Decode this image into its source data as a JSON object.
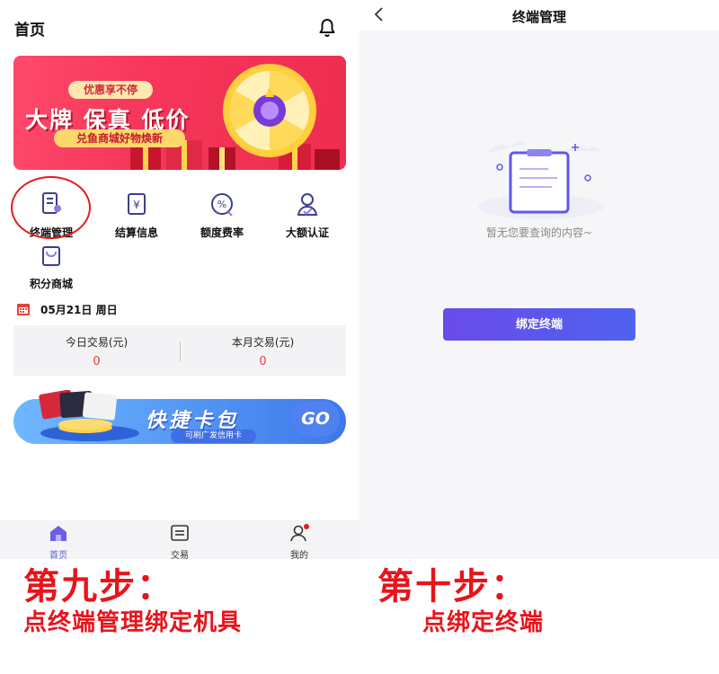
{
  "left_screen": {
    "title": "首页",
    "banner": {
      "pill": "优惠享不停",
      "title": "大牌 保真 低价",
      "subtitle": "兑鱼商城好物焕新"
    },
    "menu": [
      {
        "label": "终端管理",
        "icon": "terminal-icon"
      },
      {
        "label": "结算信息",
        "icon": "settlement-icon"
      },
      {
        "label": "额度费率",
        "icon": "rate-icon"
      },
      {
        "label": "大额认证",
        "icon": "verify-user-icon"
      },
      {
        "label": "积分商城",
        "icon": "shopping-bag-icon"
      }
    ],
    "date": "05月21日  周日",
    "stats": [
      {
        "label": "今日交易(元)",
        "value": "0"
      },
      {
        "label": "本月交易(元)",
        "value": "0"
      }
    ],
    "card_banner": {
      "title": "快捷卡包",
      "subtitle": "可刷广发信用卡",
      "go": "GO"
    },
    "tabs": [
      {
        "label": "首页",
        "icon": "home-icon",
        "active": true
      },
      {
        "label": "交易",
        "icon": "transaction-icon",
        "active": false
      },
      {
        "label": "我的",
        "icon": "profile-icon",
        "active": false
      }
    ]
  },
  "right_screen": {
    "title": "终端管理",
    "empty_text": "暂无您要查询的内容~",
    "bind_button": "绑定终端"
  },
  "captions": {
    "step9_title": "第九步：",
    "step9_desc": "点终端管理绑定机具",
    "step10_title": "第十步：",
    "step10_desc": "点绑定终端"
  },
  "colors": {
    "accent": "#5b5bd6",
    "caption_red": "#e8141c",
    "value_red": "#e0443a"
  }
}
